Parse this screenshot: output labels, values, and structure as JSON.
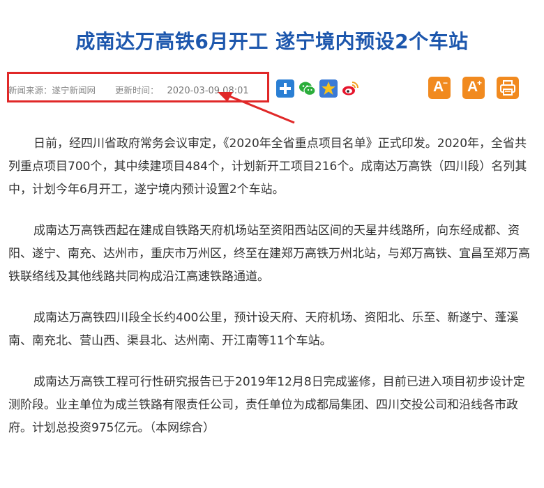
{
  "article": {
    "title": "成南达万高铁6月开工 遂宁境内预设2个车站",
    "source_label": "新闻来源：遂宁新闻网",
    "time_label": "更新时间：",
    "time": "2020-03-09 08:01",
    "paragraphs": [
      "日前，经四川省政府常务会议审定，《2020年全省重点项目名单》正式印发。2020年，全省共列重点项目700个，其中续建项目484个，计划新开工项目216个。成南达万高铁（四川段）名列其中，计划今年6月开工，遂宁境内预计设置2个车站。",
      "成南达万高铁西起在建成自铁路天府机场站至资阳西站区间的天星井线路所，向东经成都、资阳、遂宁、南充、达州市，重庆市万州区，终至在建郑万高铁万州北站，与郑万高铁、宜昌至郑万高铁联络线及其他线路共同构成沿江高速铁路通道。",
      "成南达万高铁四川段全长约400公里，预计设天府、天府机场、资阳北、乐至、新遂宁、蓬溪南、南充北、营山西、渠县北、达州南、开江南等11个车站。",
      "成南达万高铁工程可行性研究报告已于2019年12月8日完成鉴修，目前已进入项目初步设计定测阶段。业主单位为成兰铁路有限责任公司，责任单位为成都局集团、四川交投公司和沿线各市政府。计划总投资975亿元。（本网综合）"
    ]
  },
  "toolbar": {
    "share_icons": [
      "plus-icon",
      "wechat-icon",
      "qzone-star-icon",
      "weibo-icon"
    ],
    "font_small_label": "A",
    "font_small_sup": "−",
    "font_big_label": "A",
    "font_big_sup": "+",
    "print_icon": "printer-icon"
  },
  "colors": {
    "title": "#1d57ad",
    "highlight_box": "#e02828",
    "tool_orange": "#f18a1f",
    "share_blue": "#2a7fd4"
  }
}
